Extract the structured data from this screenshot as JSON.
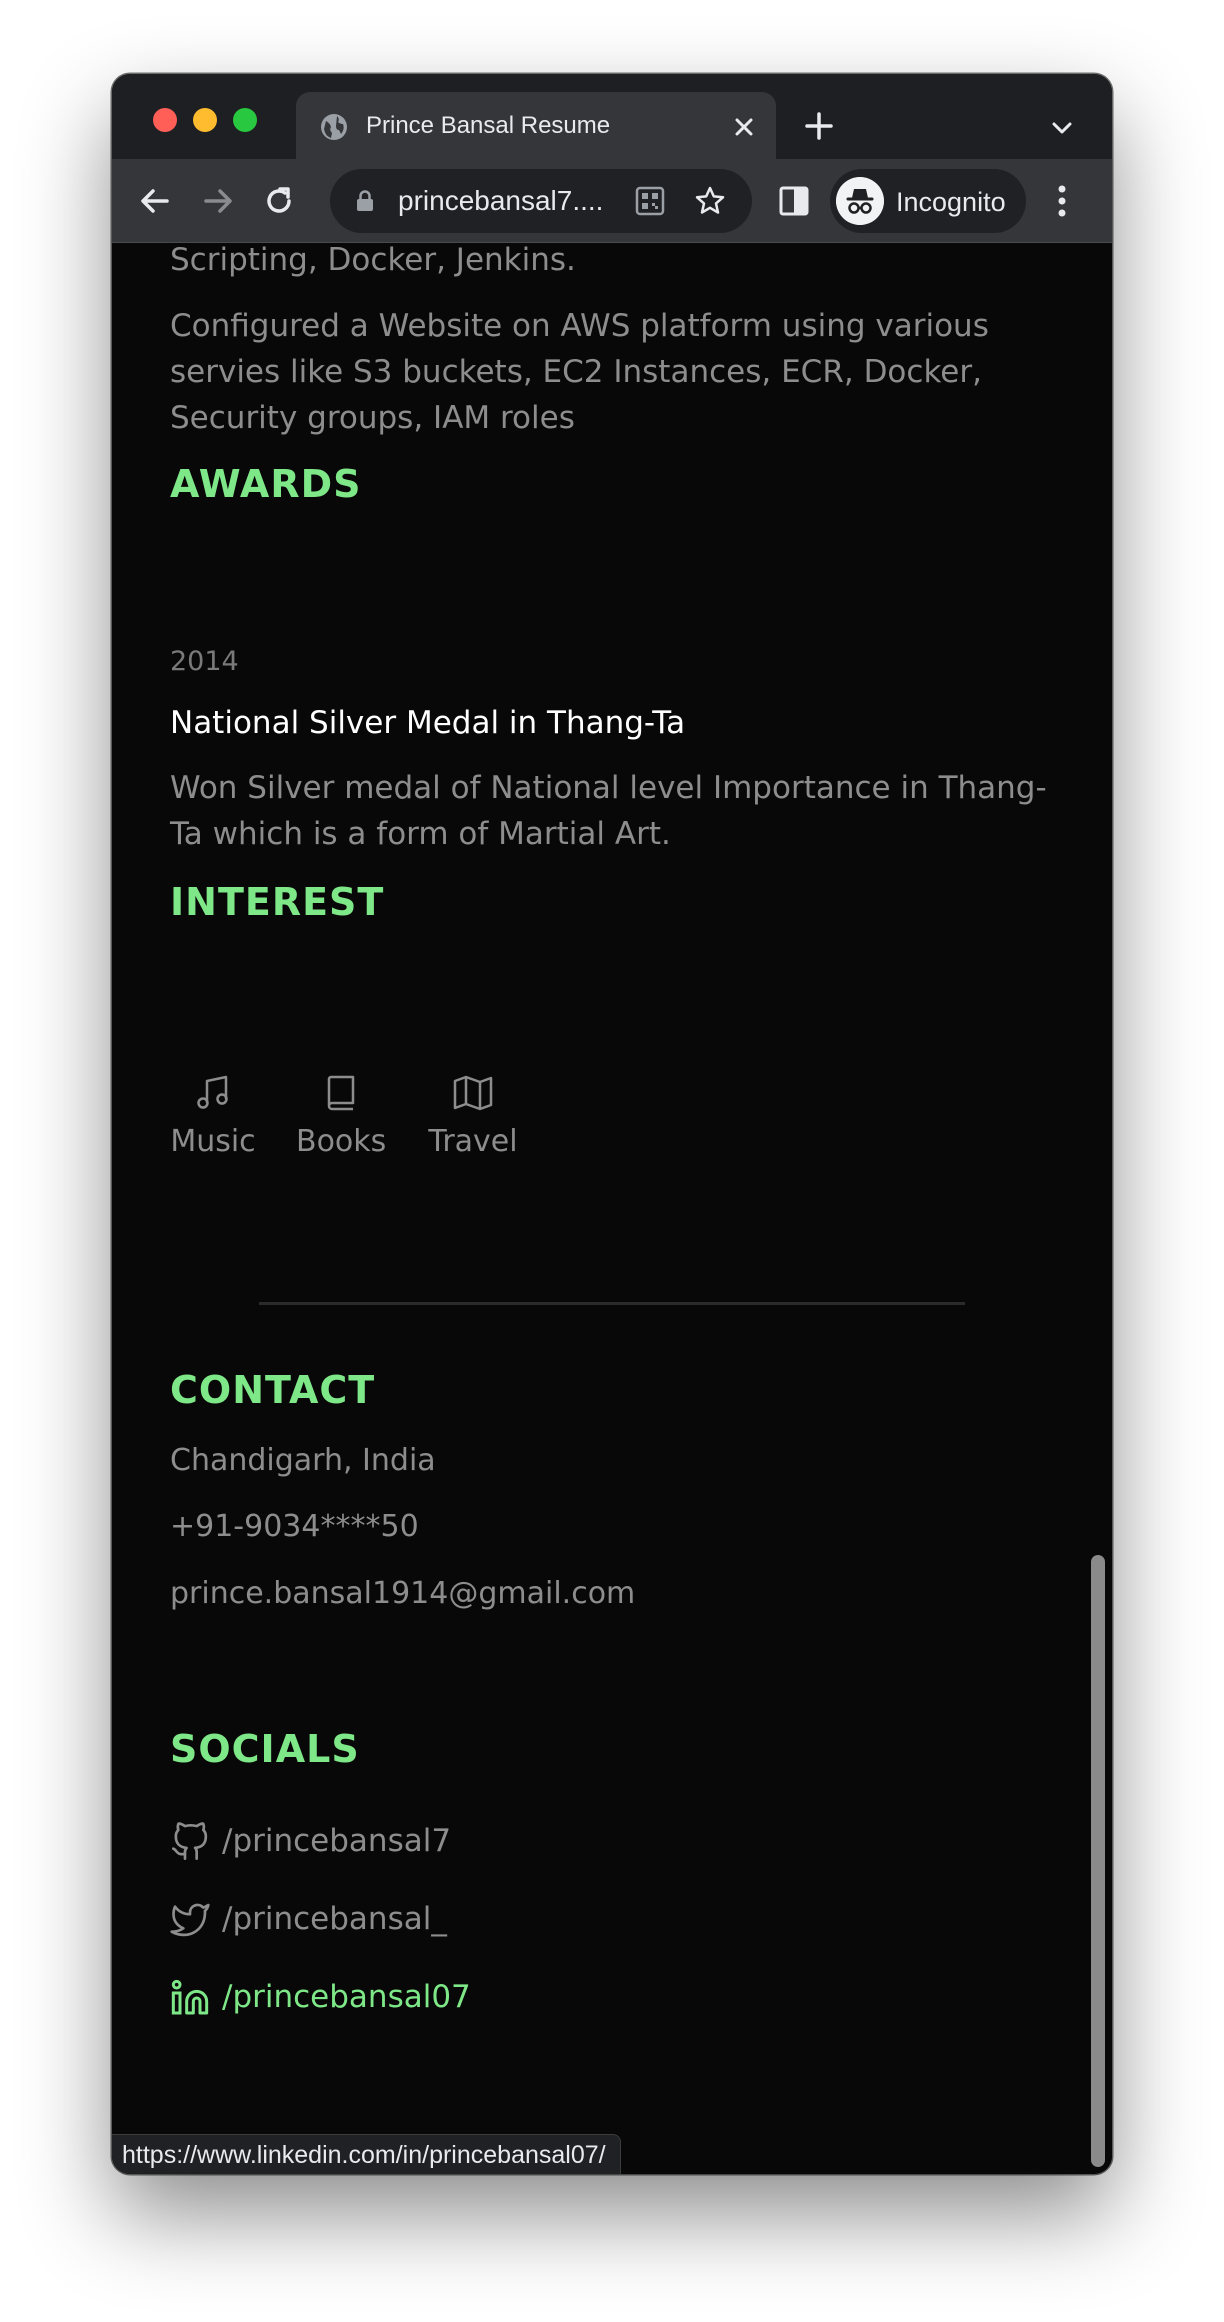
{
  "browser": {
    "tab_title": "Prince Bansal Resume",
    "url": "princebansal7....",
    "profile_label": "Incognito",
    "status_url": "https://www.linkedin.com/in/princebansal07/"
  },
  "colors": {
    "accent": "#7ee787",
    "page_bg": "#080808",
    "muted_text": "#8d8d8d"
  },
  "experience": {
    "line_partial": "Scripting, Docker, Jenkins.",
    "paragraph": "Configured a Website on AWS platform using various servies like S3 buckets, EC2 Instances, ECR, Docker, Security groups, IAM roles"
  },
  "awards": {
    "heading": "AWARDS",
    "items": [
      {
        "year": "2014",
        "title": "National Silver Medal in Thang-Ta",
        "description": "Won Silver medal of National level Importance in Thang-Ta which is a form of Martial Art."
      }
    ]
  },
  "interest": {
    "heading": "INTEREST",
    "items": [
      {
        "label": "Music",
        "icon": "music-note-icon"
      },
      {
        "label": "Books",
        "icon": "book-icon"
      },
      {
        "label": "Travel",
        "icon": "map-icon"
      }
    ]
  },
  "contact": {
    "heading": "CONTACT",
    "location": "Chandigarh, India",
    "phone": "+91-9034****50",
    "email": "prince.bansal1914@gmail.com"
  },
  "socials": {
    "heading": "SOCIALS",
    "items": [
      {
        "label": "/princebansal7",
        "icon": "github-icon"
      },
      {
        "label": "/princebansal_",
        "icon": "twitter-icon"
      },
      {
        "label": "/princebansal07",
        "icon": "linkedin-icon"
      }
    ]
  }
}
